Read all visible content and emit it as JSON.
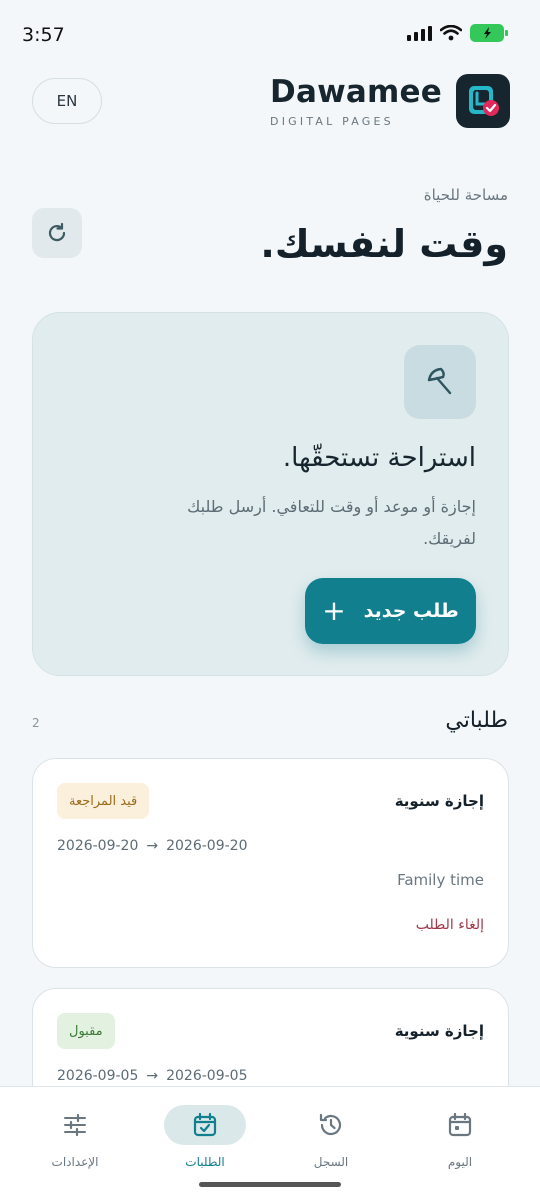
{
  "status_bar": {
    "time": "3:57"
  },
  "header": {
    "lang_button": "EN",
    "brand_name": "Dawamee",
    "brand_sub": "DIGITAL PAGES"
  },
  "intro": {
    "eyebrow": "مساحة للحياة",
    "headline": "وقت لنفسك."
  },
  "hero": {
    "icon": "umbrella-icon",
    "title": "استراحة تستحقّها.",
    "subtitle": "إجازة أو موعد أو وقت للتعافي. أرسل طلبك لفريقك.",
    "button_label": "طلب جديد"
  },
  "requests": {
    "title": "طلباتي",
    "count": "2",
    "items": [
      {
        "type": "إجازة سنوية",
        "status": "قيد المراجعة",
        "start": "2026-09-20",
        "arrow": "→",
        "end": "2026-09-20",
        "note": "Family time",
        "cancel_label": "إلغاء الطلب"
      },
      {
        "type": "إجازة سنوية",
        "status": "مقبول",
        "start": "2026-09-05",
        "arrow": "→",
        "end": "2026-09-05"
      }
    ]
  },
  "bottom_nav": [
    {
      "label": "الإعدادات",
      "icon": "sliders-icon"
    },
    {
      "label": "الطلبات",
      "icon": "calendar-check-icon",
      "active": true
    },
    {
      "label": "السجل",
      "icon": "history-icon"
    },
    {
      "label": "اليوم",
      "icon": "calendar-icon"
    }
  ],
  "colors": {
    "accent": "#117f8e",
    "background": "#f3f7f9",
    "pending_badge": "#fbf0dc",
    "approved_badge": "#e3f1e1"
  }
}
